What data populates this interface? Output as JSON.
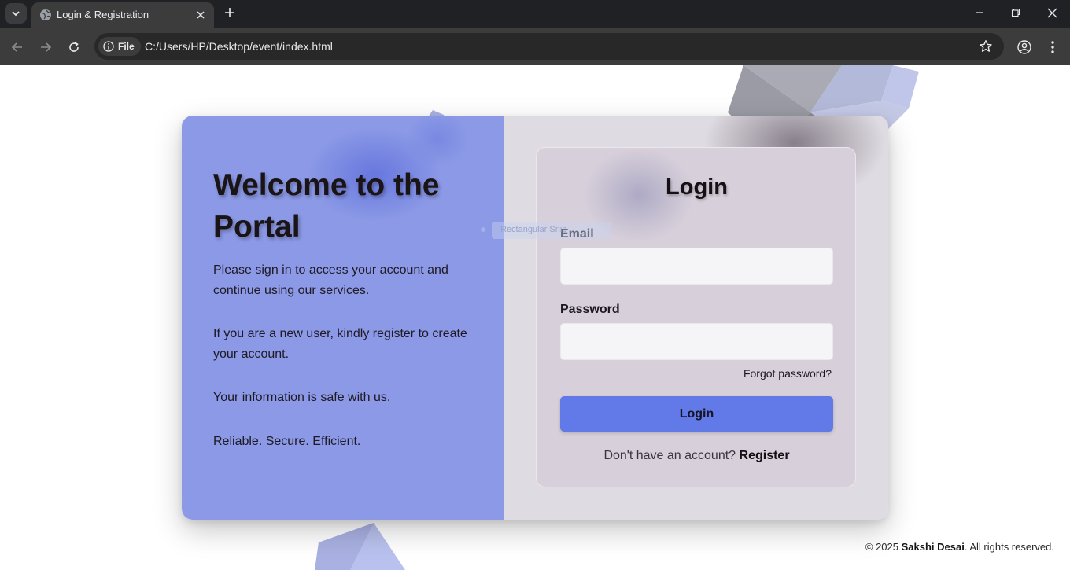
{
  "browser": {
    "tab_title": "Login & Registration",
    "site_chip": "File",
    "url": "C:/Users/HP/Desktop/event/index.html"
  },
  "portal": {
    "welcome_title": "Welcome to the Portal",
    "paragraphs": [
      "Please sign in to access your account and continue using our services.",
      "If you are a new user, kindly register to create your account.",
      "Your information is safe with us.",
      "Reliable. Secure. Efficient."
    ]
  },
  "login": {
    "title": "Login",
    "email_label": "Email",
    "email_value": "",
    "password_label": "Password",
    "password_value": "",
    "forgot": "Forgot password?",
    "button": "Login",
    "no_account": "Don't have an account?",
    "register": "Register"
  },
  "overlay": {
    "ghost_label": "Rectangular Snip"
  },
  "footer": {
    "copyright": "© 2025",
    "author": "Sakshi Desai",
    "rights": ". All rights reserved."
  },
  "colors": {
    "left_panel": "#8b99e6",
    "right_panel": "#dfdbe2",
    "login_button": "#6279e8",
    "chrome_dark": "#202124",
    "chrome_toolbar": "#3c3c3c"
  },
  "icons": [
    "tab-search-icon",
    "globe-icon",
    "close-icon",
    "plus-icon",
    "minimize-icon",
    "restore-icon",
    "window-close-icon",
    "back-arrow-icon",
    "forward-arrow-icon",
    "reload-icon",
    "info-icon",
    "star-icon",
    "profile-icon",
    "more-icon"
  ]
}
